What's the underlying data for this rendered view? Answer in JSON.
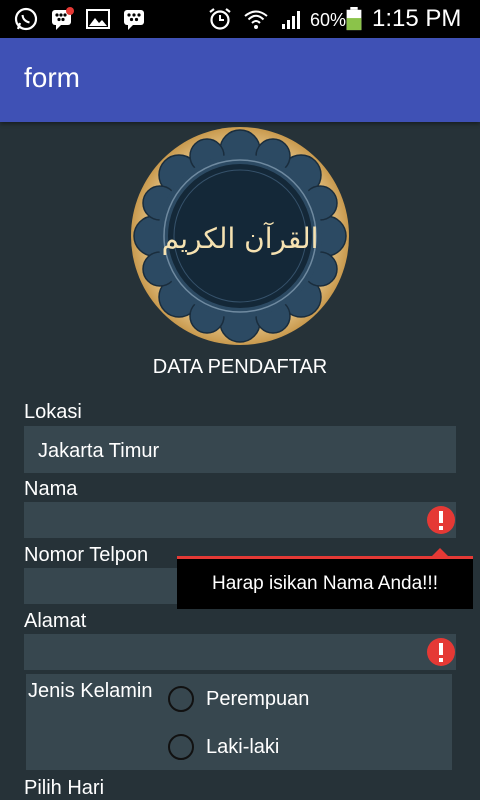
{
  "status_bar": {
    "battery": "60%",
    "time": "1:15 PM",
    "icons": [
      "whatsapp-icon",
      "bbm-notification-icon",
      "gallery-icon",
      "bbm-icon",
      "alarm-icon",
      "wifi-icon",
      "signal-icon",
      "battery-icon"
    ]
  },
  "app_bar": {
    "title": "form"
  },
  "header": {
    "logo_text": "القرآن الكريم",
    "section_title": "DATA PENDAFTAR"
  },
  "form": {
    "lokasi": {
      "label": "Lokasi",
      "value": "Jakarta Timur"
    },
    "nama": {
      "label": "Nama",
      "value": ""
    },
    "nomor_telpon": {
      "label": "Nomor Telpon",
      "value": ""
    },
    "alamat": {
      "label": "Alamat",
      "value": ""
    },
    "jenis_kelamin": {
      "label": "Jenis Kelamin",
      "options": [
        "Perempuan",
        "Laki-laki"
      ]
    },
    "pilih_hari": {
      "label": "Pilih Hari"
    }
  },
  "error_tooltip": {
    "message": "Harap isikan Nama Anda!!!"
  },
  "colors": {
    "app_bar": "#3f51b5",
    "background": "#263238",
    "field": "#37474f",
    "error": "#e53935"
  }
}
